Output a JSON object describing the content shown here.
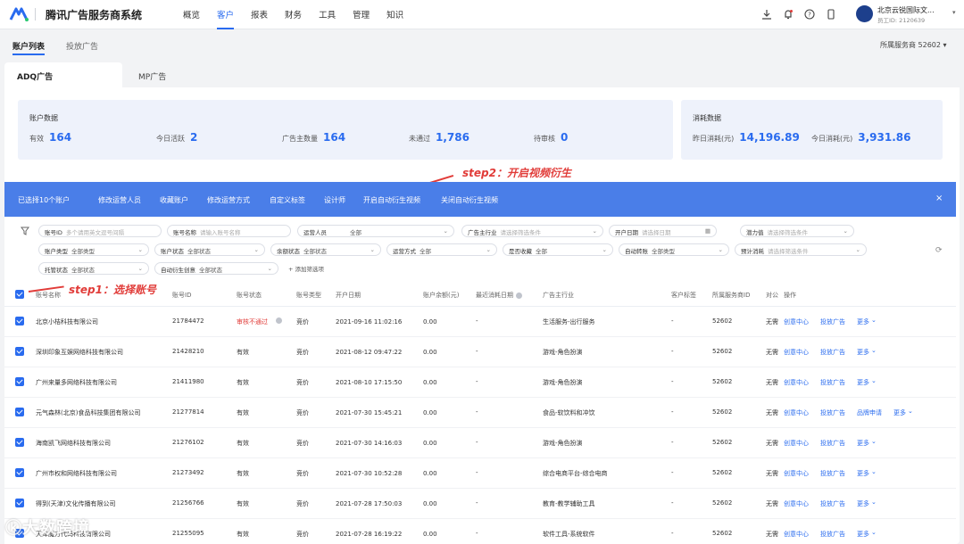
{
  "app": {
    "title": "腾讯广告服务商系统"
  },
  "nav": [
    "概览",
    "客户",
    "报表",
    "财务",
    "工具",
    "管理",
    "知识"
  ],
  "user": {
    "company": "北京云锐国际文...",
    "emp_id": "员工ID: 2120639"
  },
  "subtabs": [
    "账户列表",
    "投放广告"
  ],
  "service_provider": "所属服务商  52602",
  "ad_tabs": [
    "ADQ广告",
    "MP广告"
  ],
  "account_stats": {
    "title": "账户数据",
    "items": [
      {
        "label": "有效",
        "value": "164"
      },
      {
        "label": "今日活跃",
        "value": "2"
      },
      {
        "label": "广告主数量",
        "value": "164"
      },
      {
        "label": "未通过",
        "value": "1,786"
      },
      {
        "label": "待审核",
        "value": "0"
      }
    ]
  },
  "consume_stats": {
    "title": "消耗数据",
    "items": [
      {
        "label": "昨日消耗(元)",
        "value": "14,196.89"
      },
      {
        "label": "今日消耗(元)",
        "value": "3,931.86"
      }
    ]
  },
  "annotations": {
    "step1": "step1：选择账号",
    "step2": "step2：开启视频衍生"
  },
  "bulk_bar": {
    "selected": "已选择10个账户",
    "actions": [
      "修改运营人员",
      "收藏账户",
      "修改运营方式",
      "自定义标签",
      "设计师",
      "开启自动衍生视频",
      "关闭自动衍生视频"
    ],
    "close": "×"
  },
  "filters": {
    "account_id": {
      "label": "账号ID",
      "placeholder": "多个请用英文逗号间隔"
    },
    "account_name": {
      "label": "账号名称",
      "placeholder": "请输入账号名称"
    },
    "operator": {
      "label": "运营人员",
      "value": "全部"
    },
    "industry": {
      "label": "广告主行业",
      "placeholder": "请选择筛选条件"
    },
    "open_date": {
      "label": "开户日期",
      "placeholder": "请选择日期"
    },
    "potential": {
      "label": "潜力值",
      "placeholder": "请选择筛选条件"
    },
    "account_type": {
      "label": "账户类型",
      "value": "全部类型"
    },
    "account_status": {
      "label": "账户状态",
      "value": "全部状态"
    },
    "balance_status": {
      "label": "余额状态",
      "value": "全部状态"
    },
    "ops_mode": {
      "label": "运营方式",
      "value": "全部"
    },
    "favorited": {
      "label": "是否收藏",
      "value": "全部"
    },
    "auto_transfer": {
      "label": "自动转账",
      "value": "全部类型"
    },
    "est_consume": {
      "label": "预计消耗",
      "placeholder": "请选择筛选条件"
    },
    "trustee": {
      "label": "托管状态",
      "value": "全部状态"
    },
    "auto_derive": {
      "label": "自动衍生创意",
      "value": "全部状态"
    },
    "add_filter": "+ 添加筛选项"
  },
  "table": {
    "headers": [
      "账号名称",
      "账号ID",
      "账号状态",
      "账号类型",
      "开户日期",
      "账户余额(元)",
      "最近消耗日期",
      "广告主行业",
      "客户标签",
      "所属服务商ID",
      "对公",
      "操作"
    ],
    "rows": [
      {
        "name": "北京小桔科技有限公司",
        "id": "21784472",
        "status": "审核不通过",
        "type": "竞价",
        "date": "2021-09-16 11:02:16",
        "balance": "0.00",
        "last": "-",
        "industry": "生活服务-出行服务",
        "tag": "-",
        "sp": "52602",
        "pub": "无需",
        "actions": [
          "创意中心",
          "投放广告",
          "更多"
        ]
      },
      {
        "name": "深圳印象互娱网络科技有限公司",
        "id": "21428210",
        "status": "有效",
        "type": "竞价",
        "date": "2021-08-12 09:47:22",
        "balance": "0.00",
        "last": "-",
        "industry": "游戏-角色扮演",
        "tag": "-",
        "sp": "52602",
        "pub": "无需",
        "actions": [
          "创意中心",
          "投放广告",
          "更多"
        ]
      },
      {
        "name": "广州来量多网络科技有限公司",
        "id": "21411980",
        "status": "有效",
        "type": "竞价",
        "date": "2021-08-10 17:15:50",
        "balance": "0.00",
        "last": "-",
        "industry": "游戏-角色扮演",
        "tag": "-",
        "sp": "52602",
        "pub": "无需",
        "actions": [
          "创意中心",
          "投放广告",
          "更多"
        ]
      },
      {
        "name": "元气森林(北京)食品科技集团有限公司",
        "id": "21277814",
        "status": "有效",
        "type": "竞价",
        "date": "2021-07-30 15:45:21",
        "balance": "0.00",
        "last": "-",
        "industry": "食品-软饮料和冲饮",
        "tag": "-",
        "sp": "52602",
        "pub": "无需",
        "actions": [
          "创意中心",
          "投放广告",
          "品牌申请",
          "更多"
        ]
      },
      {
        "name": "海南凯飞网络科技有限公司",
        "id": "21276102",
        "status": "有效",
        "type": "竞价",
        "date": "2021-07-30 14:16:03",
        "balance": "0.00",
        "last": "-",
        "industry": "游戏-角色扮演",
        "tag": "-",
        "sp": "52602",
        "pub": "无需",
        "actions": [
          "创意中心",
          "投放广告",
          "更多"
        ]
      },
      {
        "name": "广州市权和网络科技有限公司",
        "id": "21273492",
        "status": "有效",
        "type": "竞价",
        "date": "2021-07-30 10:52:28",
        "balance": "0.00",
        "last": "-",
        "industry": "综合电商平台-综合电商",
        "tag": "-",
        "sp": "52602",
        "pub": "无需",
        "actions": [
          "创意中心",
          "投放广告",
          "更多"
        ]
      },
      {
        "name": "得到(天津)文化传播有限公司",
        "id": "21256766",
        "status": "有效",
        "type": "竞价",
        "date": "2021-07-28 17:50:03",
        "balance": "0.00",
        "last": "-",
        "industry": "教育-教学辅助工具",
        "tag": "-",
        "sp": "52602",
        "pub": "无需",
        "actions": [
          "创意中心",
          "投放广告",
          "更多"
        ]
      },
      {
        "name": "天津魔方代码科技有限公司",
        "id": "21255095",
        "status": "有效",
        "type": "竞价",
        "date": "2021-07-28 16:19:22",
        "balance": "0.00",
        "last": "-",
        "industry": "软件工具-系统软件",
        "tag": "-",
        "sp": "52602",
        "pub": "无需",
        "actions": [
          "创意中心",
          "投放广告",
          "更多"
        ]
      }
    ]
  },
  "watermark": "大数跨境",
  "colors": {
    "primary": "#296bef",
    "bulk_bar": "#4a7ee8",
    "annotation": "#e13c39"
  }
}
